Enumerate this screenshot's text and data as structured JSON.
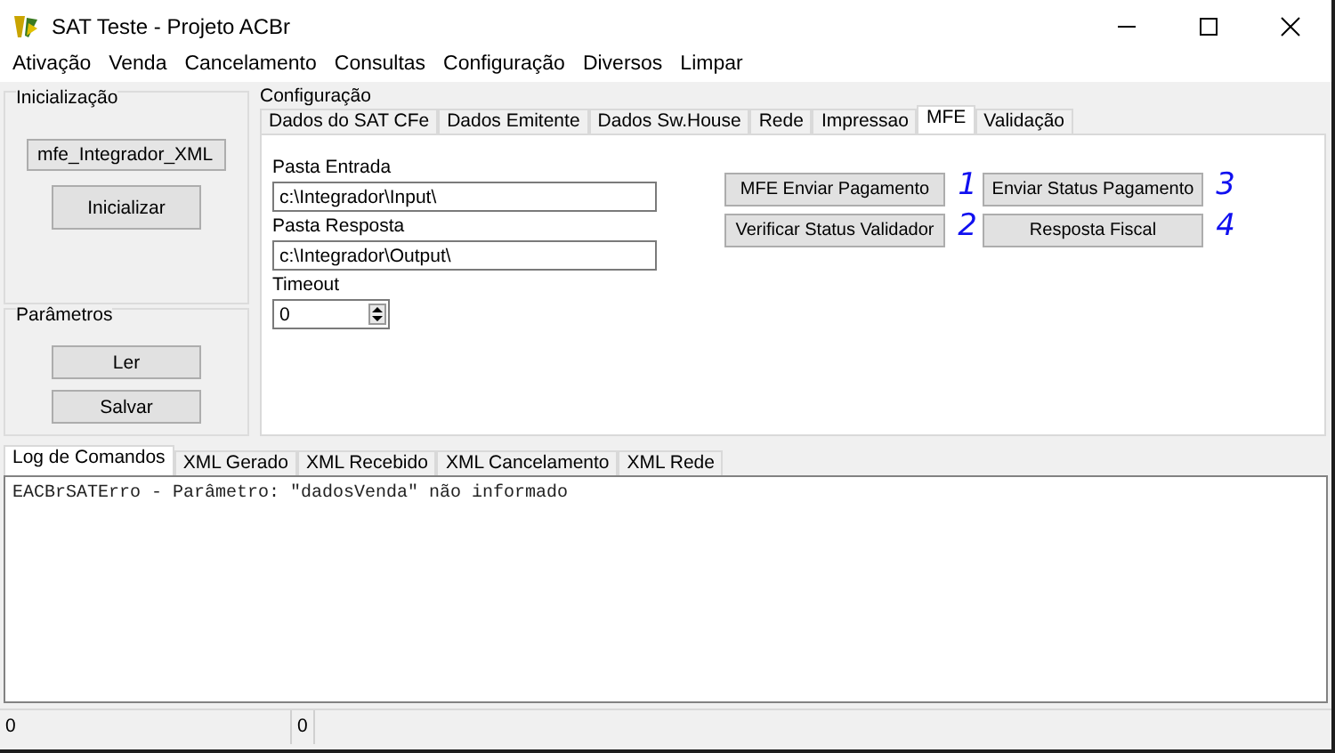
{
  "window": {
    "title": "SAT Teste - Projeto ACBr"
  },
  "menu": [
    "Ativação",
    "Venda",
    "Cancelamento",
    "Consultas",
    "Configuração",
    "Diversos",
    "Limpar"
  ],
  "init_group": {
    "title": "Inicialização",
    "model": "mfe_Integrador_XML",
    "button": "Inicializar"
  },
  "params_group": {
    "title": "Parâmetros",
    "buttons": [
      "Ler",
      "Salvar"
    ]
  },
  "config_group": {
    "title": "Configuração",
    "tabs": [
      {
        "label": "Dados do SAT CFe",
        "selected": false
      },
      {
        "label": "Dados Emitente",
        "selected": false
      },
      {
        "label": "Dados Sw.House",
        "selected": false
      },
      {
        "label": "Rede",
        "selected": false
      },
      {
        "label": "Impressao",
        "selected": false
      },
      {
        "label": "MFE",
        "selected": true
      },
      {
        "label": "Validação",
        "selected": false
      }
    ],
    "fields": [
      {
        "label": "Pasta Entrada",
        "value": "c:\\Integrador\\Input\\"
      },
      {
        "label": "Pasta Resposta",
        "value": "c:\\Integrador\\Output\\"
      }
    ],
    "timeout": {
      "label": "Timeout",
      "value": "0"
    },
    "actions": [
      {
        "label": "MFE Enviar Pagamento",
        "note": "1"
      },
      {
        "label": "Enviar Status Pagamento",
        "note": "3"
      },
      {
        "label": "Verificar Status Validador",
        "note": "2"
      },
      {
        "label": "Resposta Fiscal",
        "note": "4"
      }
    ]
  },
  "log_tabs": [
    {
      "label": "Log de Comandos",
      "selected": true
    },
    {
      "label": "XML Gerado",
      "selected": false
    },
    {
      "label": "XML Recebido",
      "selected": false
    },
    {
      "label": "XML Cancelamento",
      "selected": false
    },
    {
      "label": "XML Rede",
      "selected": false
    }
  ],
  "log": "EACBrSATErro - Parâmetro: \"dadosVenda\" não informado",
  "status_bar": [
    "0",
    "0"
  ]
}
